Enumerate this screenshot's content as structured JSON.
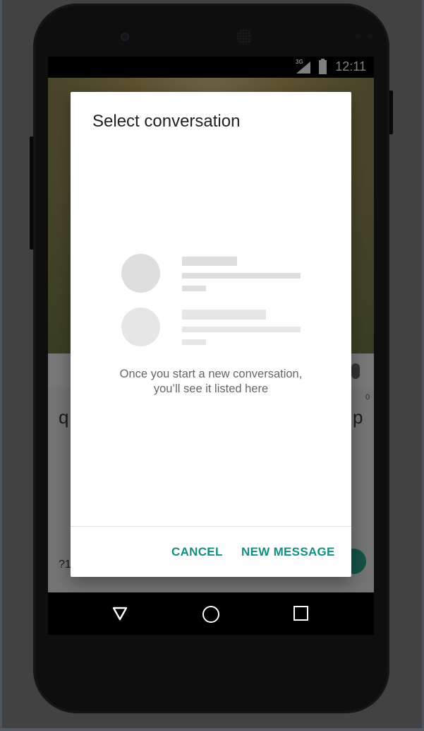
{
  "status_bar": {
    "time": "12:11",
    "network": "3G",
    "icons": [
      "signal-icon",
      "battery-icon"
    ]
  },
  "keyboard_background": {
    "left_key": "q",
    "right_key": "p",
    "right_hint": "0",
    "symbols_key": "?1"
  },
  "dialog": {
    "title": "Select conversation",
    "empty_state_text": "Once you start a new conversation, you’ll see it listed here",
    "cancel_label": "CANCEL",
    "new_message_label": "NEW MESSAGE"
  },
  "nav_bar": {
    "icons": [
      "back-icon",
      "home-icon",
      "recents-icon"
    ]
  },
  "colors": {
    "accent": "#12907f",
    "dialog_bg": "#ffffff",
    "scrim": "#00000080",
    "placeholder": "#dedede"
  }
}
